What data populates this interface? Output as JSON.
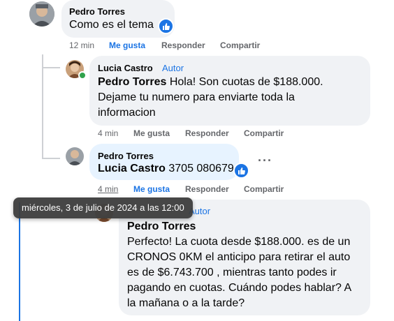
{
  "comments": [
    {
      "author": "Pedro Torres",
      "text": "Como es el tema",
      "time": "12 min",
      "actions": [
        "Me gusta",
        "Responder",
        "Compartir"
      ]
    },
    {
      "author": "Lucia Castro",
      "badge": "Autor",
      "mention": "Pedro Torres",
      "text": " Hola! Son cuotas de $188.000. Dejame tu numero para enviarte toda la informacion",
      "time": "4 min",
      "actions": [
        "Me gusta",
        "Responder",
        "Compartir"
      ]
    },
    {
      "author": "Pedro Torres",
      "mention": "Lucia Castro",
      "text": " 3705 080679",
      "time": "4 min",
      "actions": [
        "Me gusta",
        "Responder",
        "Compartir"
      ],
      "more": "···"
    },
    {
      "badge": "Autor",
      "mention": "Pedro Torres",
      "text": "Perfecto! La cuota desde $188.000. es de un CRONOS 0KM el anticipo para retirar el auto es de $6.743.700 , mientras tanto podes ir pagando en cuotas. Cuándo podes hablar? A la mañana o a la tarde?"
    }
  ],
  "tooltip": "miércoles, 3 de julio de 2024 a las 12:00",
  "colors": {
    "like_blue": "#1b74e4",
    "bubble": "#f0f2f5",
    "highlight": "#e7f3ff",
    "online": "#31a24c"
  }
}
